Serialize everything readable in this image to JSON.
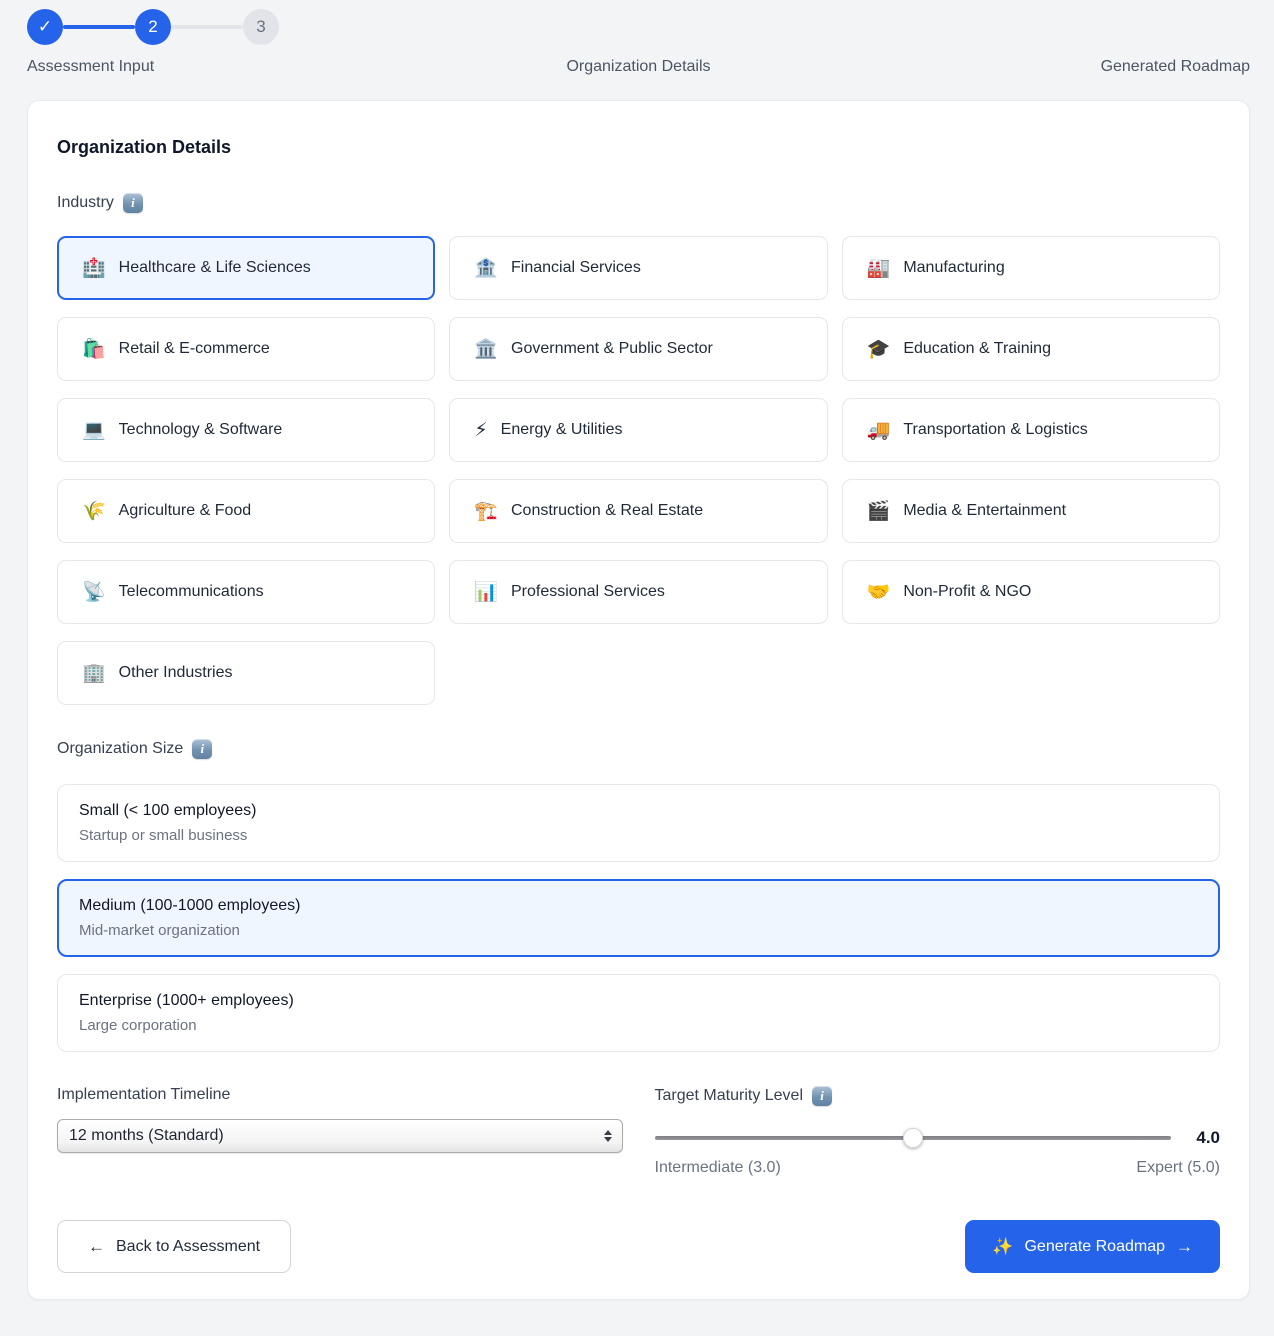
{
  "stepper": {
    "steps": [
      {
        "indicator": "✓",
        "label": "Assessment Input",
        "state": "complete"
      },
      {
        "indicator": "2",
        "label": "Organization Details",
        "state": "active"
      },
      {
        "indicator": "3",
        "label": "Generated Roadmap",
        "state": "upcoming"
      }
    ]
  },
  "card": {
    "title": "Organization Details",
    "industry": {
      "label": "Industry",
      "info_icon": "i",
      "options": [
        {
          "icon": "🏥",
          "label": "Healthcare & Life Sciences",
          "selected": true
        },
        {
          "icon": "🏦",
          "label": "Financial Services",
          "selected": false
        },
        {
          "icon": "🏭",
          "label": "Manufacturing",
          "selected": false
        },
        {
          "icon": "🛍️",
          "label": "Retail & E-commerce",
          "selected": false
        },
        {
          "icon": "🏛️",
          "label": "Government & Public Sector",
          "selected": false
        },
        {
          "icon": "🎓",
          "label": "Education & Training",
          "selected": false
        },
        {
          "icon": "💻",
          "label": "Technology & Software",
          "selected": false
        },
        {
          "icon": "⚡",
          "label": "Energy & Utilities",
          "selected": false
        },
        {
          "icon": "🚚",
          "label": "Transportation & Logistics",
          "selected": false
        },
        {
          "icon": "🌾",
          "label": "Agriculture & Food",
          "selected": false
        },
        {
          "icon": "🏗️",
          "label": "Construction & Real Estate",
          "selected": false
        },
        {
          "icon": "🎬",
          "label": "Media & Entertainment",
          "selected": false
        },
        {
          "icon": "📡",
          "label": "Telecommunications",
          "selected": false
        },
        {
          "icon": "📊",
          "label": "Professional Services",
          "selected": false
        },
        {
          "icon": "🤝",
          "label": "Non-Profit & NGO",
          "selected": false
        },
        {
          "icon": "🏢",
          "label": "Other Industries",
          "selected": false
        }
      ]
    },
    "organization_size": {
      "label": "Organization Size",
      "info_icon": "i",
      "options": [
        {
          "title": "Small (< 100 employees)",
          "subtitle": "Startup or small business",
          "selected": false
        },
        {
          "title": "Medium (100-1000 employees)",
          "subtitle": "Mid-market organization",
          "selected": true
        },
        {
          "title": "Enterprise (1000+ employees)",
          "subtitle": "Large corporation",
          "selected": false
        }
      ]
    },
    "timeline": {
      "label": "Implementation Timeline",
      "selected_option": "12 months (Standard)"
    },
    "maturity": {
      "label": "Target Maturity Level",
      "info_icon": "i",
      "value": "4.0",
      "min_label": "Intermediate (3.0)",
      "max_label": "Expert (5.0)"
    },
    "actions": {
      "back_arrow": "←",
      "back_label": "Back to Assessment",
      "generate_icon": "✨",
      "generate_label": "Generate Roadmap",
      "generate_arrow": "→"
    }
  },
  "colors": {
    "accent": "#2563eb",
    "selected_bg": "#eff6ff",
    "page_bg": "#f3f4f6",
    "muted_text": "#6b7280"
  }
}
